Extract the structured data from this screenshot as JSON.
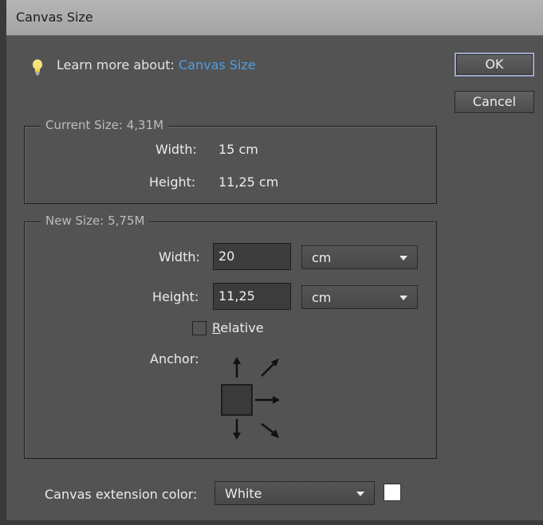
{
  "dialog": {
    "title": "Canvas Size",
    "close_glyph": "×"
  },
  "learn": {
    "prefix": "Learn more about: ",
    "link": "Canvas Size",
    "icon": "lightbulb-icon"
  },
  "buttons": {
    "ok": "OK",
    "cancel": "Cancel"
  },
  "current_size": {
    "legend": "Current Size: 4,31M",
    "width_label": "Width:",
    "width_value": "15 cm",
    "height_label": "Height:",
    "height_value": "11,25 cm"
  },
  "new_size": {
    "legend": "New Size: 5,75M",
    "width_label": "Width:",
    "width_value": "20",
    "width_unit": "cm",
    "height_label": "Height:",
    "height_value": "11,25",
    "height_unit": "cm",
    "relative_label_accel": "R",
    "relative_label_rest": "elative",
    "relative_checked": false,
    "anchor_label": "Anchor:"
  },
  "extension": {
    "label": "Canvas extension color:",
    "value": "White",
    "swatch_color": "#ffffff"
  },
  "colors": {
    "panel": "#535353",
    "link": "#4f9ce6"
  }
}
